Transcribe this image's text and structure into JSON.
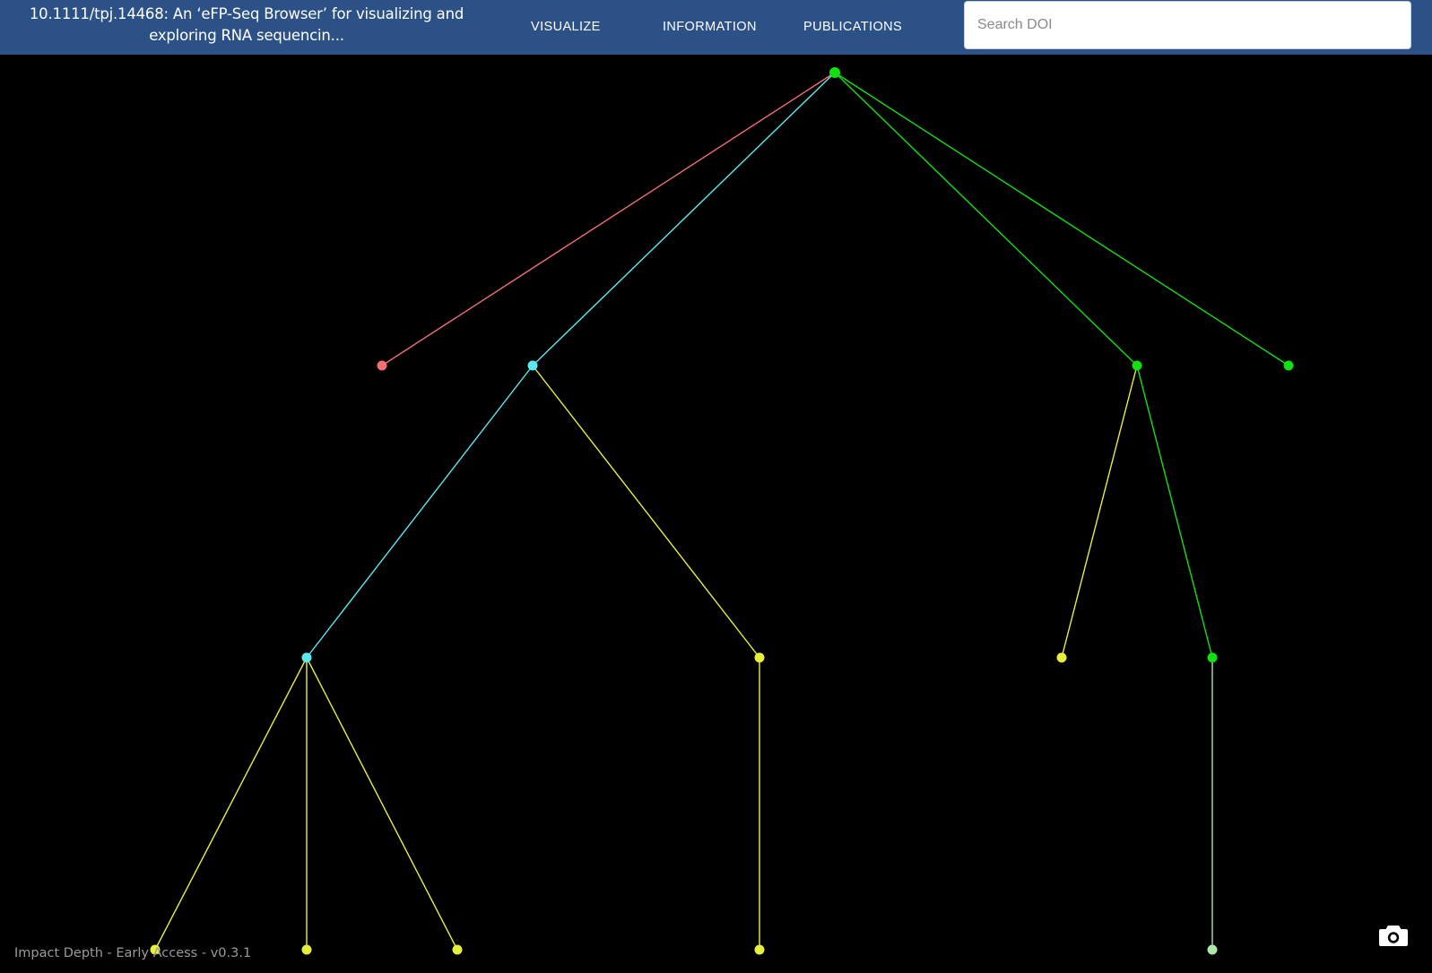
{
  "header": {
    "title": "10.1111/tpj.14468: An ‘eFP-Seq Browser’ for visualizing and\nexploring RNA sequencin...",
    "nav": [
      {
        "label": "VISUALIZE"
      },
      {
        "label": "INFORMATION"
      },
      {
        "label": "PUBLICATIONS"
      }
    ],
    "search": {
      "placeholder": "Search DOI",
      "value": ""
    }
  },
  "graph": {
    "icon": "citation-tree",
    "colors": {
      "green": "#11e011",
      "cyan": "#5ce8f0",
      "salmon": "#f07070",
      "yellow": "#e6f03c",
      "pale_green": "#a8e8a8"
    },
    "nodes": [
      {
        "id": "root",
        "color": "green"
      },
      {
        "id": "n1",
        "color": "salmon"
      },
      {
        "id": "n2",
        "color": "cyan"
      },
      {
        "id": "n3",
        "color": "green"
      },
      {
        "id": "n4",
        "color": "green"
      },
      {
        "id": "n5",
        "color": "cyan"
      },
      {
        "id": "n6",
        "color": "yellow"
      },
      {
        "id": "n7",
        "color": "yellow"
      },
      {
        "id": "n8",
        "color": "green"
      },
      {
        "id": "n9",
        "color": "yellow"
      },
      {
        "id": "n10",
        "color": "yellow"
      },
      {
        "id": "n11",
        "color": "yellow"
      },
      {
        "id": "n12",
        "color": "yellow"
      },
      {
        "id": "n13",
        "color": "pale_green"
      }
    ],
    "edges": [
      {
        "from": "root",
        "to": "n1",
        "color": "salmon"
      },
      {
        "from": "root",
        "to": "n2",
        "color": "cyan"
      },
      {
        "from": "root",
        "to": "n3",
        "color": "green"
      },
      {
        "from": "root",
        "to": "n4",
        "color": "green"
      },
      {
        "from": "n2",
        "to": "n5",
        "color": "cyan"
      },
      {
        "from": "n2",
        "to": "n6",
        "color": "yellow"
      },
      {
        "from": "n3",
        "to": "n7",
        "color": "yellow"
      },
      {
        "from": "n3",
        "to": "n8",
        "color": "green"
      },
      {
        "from": "n5",
        "to": "n9",
        "color": "yellow"
      },
      {
        "from": "n5",
        "to": "n10",
        "color": "yellow"
      },
      {
        "from": "n5",
        "to": "n11",
        "color": "yellow"
      },
      {
        "from": "n6",
        "to": "n12",
        "color": "yellow"
      },
      {
        "from": "n8",
        "to": "n13",
        "color": "pale_green"
      }
    ]
  },
  "footer": {
    "version_label": "Impact Depth - Early Access - v0.3.1",
    "screenshot_icon": "camera-icon"
  }
}
